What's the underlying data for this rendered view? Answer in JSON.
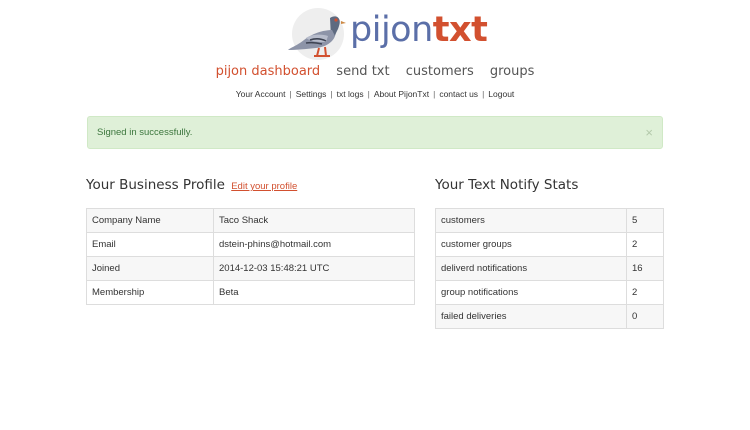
{
  "brand": {
    "part1": "pijon",
    "part2": "txt",
    "pigeon_icon": "pigeon-logo-icon"
  },
  "main_nav": [
    {
      "label": "pijon dashboard",
      "active": true
    },
    {
      "label": "send txt",
      "active": false
    },
    {
      "label": "customers",
      "active": false
    },
    {
      "label": "groups",
      "active": false
    }
  ],
  "sub_nav": [
    "Your Account",
    "Settings",
    "txt logs",
    "About PijonTxt",
    "contact us",
    "Logout"
  ],
  "alert": {
    "message": "Signed in successfully.",
    "close": "×"
  },
  "profile": {
    "title": "Your Business Profile",
    "edit_link": "Edit your profile",
    "rows": [
      {
        "key": "Company Name",
        "value": "Taco Shack"
      },
      {
        "key": "Email",
        "value": "dstein-phins@hotmail.com"
      },
      {
        "key": "Joined",
        "value": "2014-12-03 15:48:21 UTC"
      },
      {
        "key": "Membership",
        "value": "Beta"
      }
    ]
  },
  "stats": {
    "title": "Your Text Notify Stats",
    "rows": [
      {
        "key": "customers",
        "value": "5"
      },
      {
        "key": "customer groups",
        "value": "2"
      },
      {
        "key": "deliverd notifications",
        "value": "16"
      },
      {
        "key": "group notifications",
        "value": "2"
      },
      {
        "key": "failed deliveries",
        "value": "0"
      }
    ]
  },
  "colors": {
    "accent": "#d2502f",
    "brand_blue": "#5b6fa8",
    "alert_bg": "#dff0d8",
    "alert_text": "#3c763d"
  }
}
